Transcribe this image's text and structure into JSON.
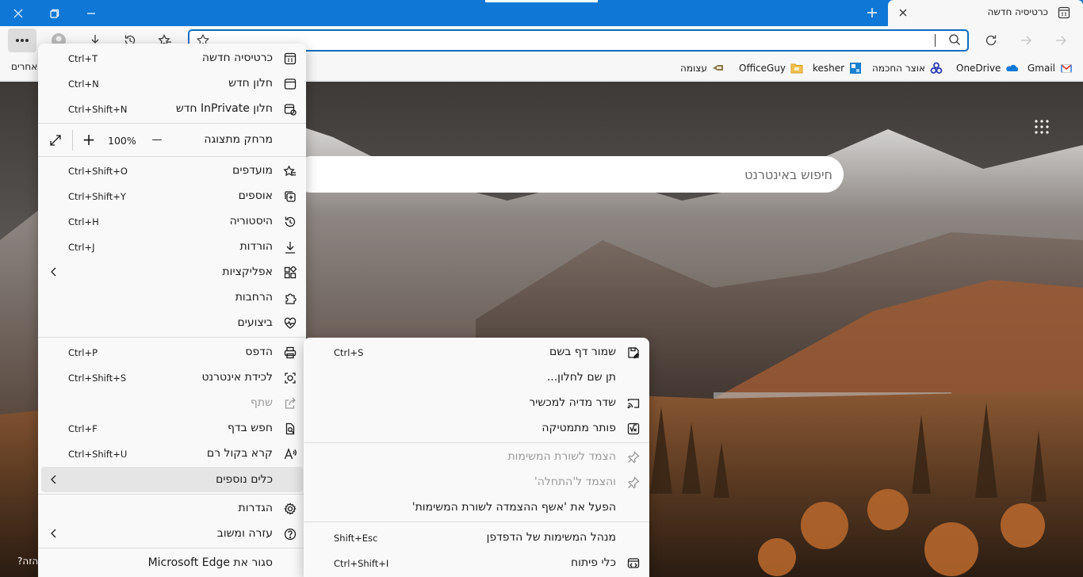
{
  "tab": {
    "title": "כרטיסיה חדשה"
  },
  "address": {
    "value": ""
  },
  "favorites": {
    "items": [
      {
        "label": "Gmail",
        "icon": "gmail-icon"
      },
      {
        "label": "OneDrive",
        "icon": "onedrive-icon"
      },
      {
        "label": "אוצר החכמה",
        "icon": "otzar-icon"
      },
      {
        "label": "kesher",
        "icon": "kesher-icon"
      },
      {
        "label": "OfficeGuy",
        "icon": "folder-icon"
      },
      {
        "label": "עצומה",
        "icon": "petition-icon"
      }
    ],
    "other": "אחרים"
  },
  "page": {
    "search_placeholder": "חיפוש באינטרנט",
    "help_text": "?הזה"
  },
  "menu": {
    "new_tab": {
      "label": "כרטיסיה חדשה",
      "shortcut": "Ctrl+T"
    },
    "new_window": {
      "label": "חלון חדש",
      "shortcut": "Ctrl+N"
    },
    "inprivate": {
      "label": "חלון InPrivate חדש",
      "shortcut": "Ctrl+Shift+N"
    },
    "zoom": {
      "label": "מרחק מתצוגה",
      "value": "100%",
      "minus": "—",
      "plus": "+"
    },
    "favorites": {
      "label": "מועדפים",
      "shortcut": "Ctrl+Shift+O"
    },
    "collections": {
      "label": "אוספים",
      "shortcut": "Ctrl+Shift+Y"
    },
    "history": {
      "label": "היסטוריה",
      "shortcut": "Ctrl+H"
    },
    "downloads": {
      "label": "הורדות",
      "shortcut": "Ctrl+J"
    },
    "apps": {
      "label": "אפליקציות"
    },
    "extensions": {
      "label": "הרחבות"
    },
    "performance": {
      "label": "ביצועים"
    },
    "print": {
      "label": "הדפס",
      "shortcut": "Ctrl+P"
    },
    "web_capture": {
      "label": "לכידת אינטרנט",
      "shortcut": "Ctrl+Shift+S"
    },
    "share": {
      "label": "שתף"
    },
    "find": {
      "label": "חפש בדף",
      "shortcut": "Ctrl+F"
    },
    "read_aloud": {
      "label": "קרא בקול רם",
      "shortcut": "Ctrl+Shift+U"
    },
    "more_tools": {
      "label": "כלים נוספים"
    },
    "settings": {
      "label": "הגדרות"
    },
    "help": {
      "label": "עזרה ומשוב"
    },
    "close": {
      "label": "סגור את Microsoft Edge"
    }
  },
  "submenu": {
    "save_as": {
      "label": "שמור דף בשם",
      "shortcut": "Ctrl+S"
    },
    "name_window": {
      "label": "תן שם לחלון..."
    },
    "cast": {
      "label": "שדר מדיה למכשיר"
    },
    "math": {
      "label": "פותר מתמטיקה"
    },
    "pin_taskbar": {
      "label": "הצמד לשורת המשימות"
    },
    "pin_start": {
      "label": "והצמד ל'התחלה'"
    },
    "pin_wizard": {
      "label": "הפעל את 'אשף ההצמדה לשורת המשימות'"
    },
    "task_manager": {
      "label": "מנהל המשימות של הדפדפן",
      "shortcut": "Shift+Esc"
    },
    "dev_tools": {
      "label": "כלי פיתוח",
      "shortcut": "Ctrl+Shift+I"
    }
  },
  "colors": {
    "titlebar": "#0f78d7",
    "accent": "#0f6cbd",
    "menu_bg": "#f9f9f9",
    "hover": "#e5e5e5"
  }
}
